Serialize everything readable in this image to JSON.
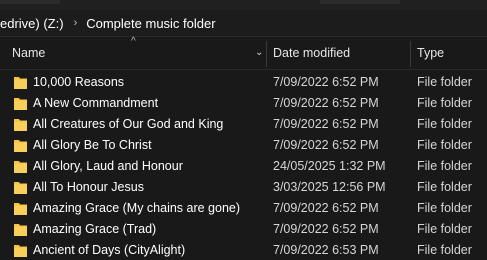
{
  "address": {
    "segments": [
      "edrive) (Z:)",
      "Complete music folder"
    ],
    "separator": "›"
  },
  "columns": {
    "name": "Name",
    "date": "Date modified",
    "type": "Type",
    "sort_indicator": "^"
  },
  "colors": {
    "folder": "#f5c242",
    "background": "#191919",
    "text": "#ffffff"
  },
  "rows": [
    {
      "name": "10,000 Reasons",
      "date": "7/09/2022 6:52 PM",
      "type": "File folder",
      "icon": "folder-icon"
    },
    {
      "name": "A New Commandment",
      "date": "7/09/2022 6:52 PM",
      "type": "File folder",
      "icon": "folder-icon"
    },
    {
      "name": "All Creatures of Our God and King",
      "date": "7/09/2022 6:52 PM",
      "type": "File folder",
      "icon": "folder-icon"
    },
    {
      "name": "All Glory Be To Christ",
      "date": "7/09/2022 6:52 PM",
      "type": "File folder",
      "icon": "folder-icon"
    },
    {
      "name": "All Glory, Laud and Honour",
      "date": "24/05/2025 1:32 PM",
      "type": "File folder",
      "icon": "folder-icon"
    },
    {
      "name": "All To Honour Jesus",
      "date": "3/03/2025 12:56 PM",
      "type": "File folder",
      "icon": "folder-icon"
    },
    {
      "name": "Amazing Grace (My chains are gone)",
      "date": "7/09/2022 6:52 PM",
      "type": "File folder",
      "icon": "folder-icon"
    },
    {
      "name": "Amazing Grace (Trad)",
      "date": "7/09/2022 6:52 PM",
      "type": "File folder",
      "icon": "folder-icon"
    },
    {
      "name": "Ancient of Days  (CityAlight)",
      "date": "7/09/2022 6:53 PM",
      "type": "File folder",
      "icon": "folder-icon"
    }
  ]
}
